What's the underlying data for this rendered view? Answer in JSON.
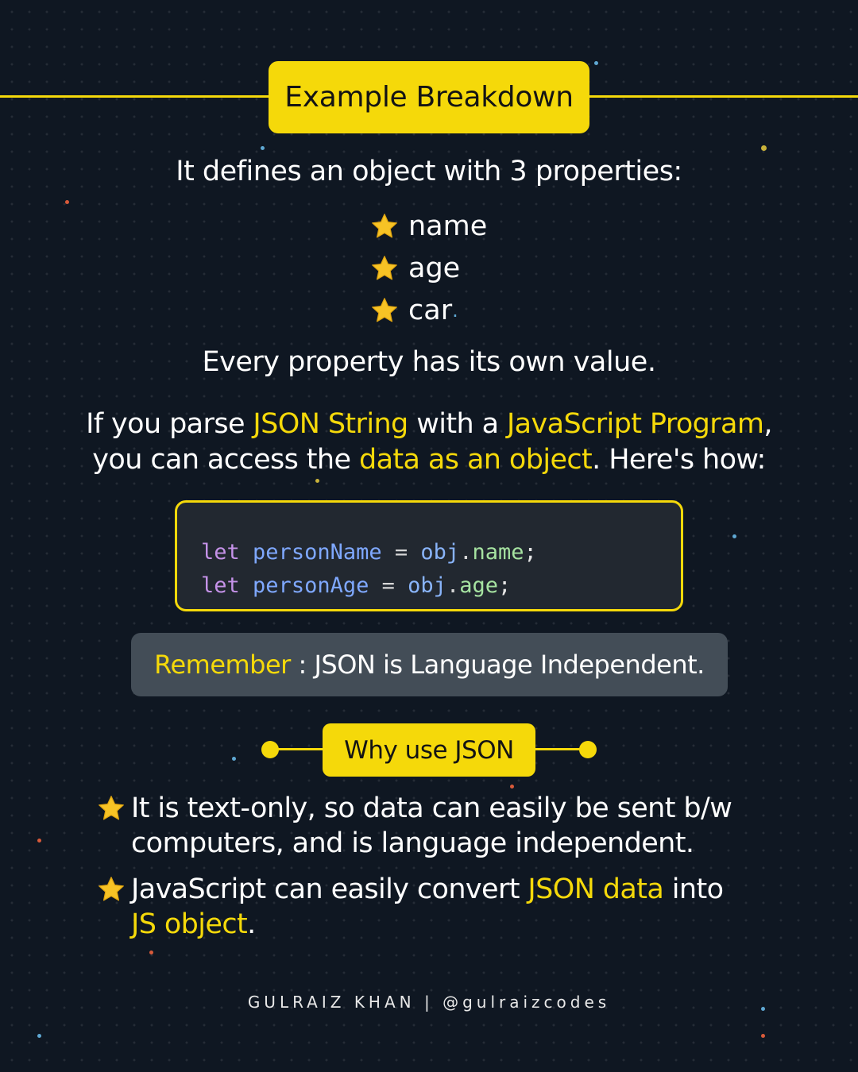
{
  "header": {
    "title": "Example Breakdown"
  },
  "intro": "It defines an object with 3 properties:",
  "properties": [
    "name",
    "age",
    "car"
  ],
  "property_list_trailing_dot": ".",
  "every": "Every property has its own value.",
  "parse": {
    "line1": {
      "t1": "If you parse ",
      "h1": "JSON String",
      "t2": " with a ",
      "h2": "JavaScript Program",
      "t3": ","
    },
    "line2": {
      "t1": "you can access the ",
      "h1": "data as an object",
      "t2": ". Here's how:"
    }
  },
  "code": {
    "line1": {
      "kw": "let",
      "var": "personName",
      "op": "=",
      "obj": "obj",
      "dot": ".",
      "prop": "name",
      "semi": ";"
    },
    "line2": {
      "kw": "let",
      "var": "personAge",
      "op": "=",
      "obj": "obj",
      "dot": ".",
      "prop": "age",
      "semi": ";"
    }
  },
  "remember": {
    "label": "Remember",
    "separator": " : ",
    "text": "JSON is Language Independent."
  },
  "why": {
    "title": "Why use JSON"
  },
  "bullets": {
    "b1": {
      "line1": "It is text-only, so data can easily be sent b/w",
      "line2": "computers, and is language independent."
    },
    "b2": {
      "t1": "JavaScript can easily convert ",
      "h1": "JSON data",
      "t2": " into",
      "h2": "JS object",
      "t3": "."
    }
  },
  "footer": "GULRAIZ KHAN | @gulraizcodes",
  "colors": {
    "accent": "#f5d90a",
    "background": "#0f1722",
    "code_bg": "#222830",
    "remember_bg": "#434d57"
  },
  "icons": {
    "bullet": "star-icon"
  }
}
